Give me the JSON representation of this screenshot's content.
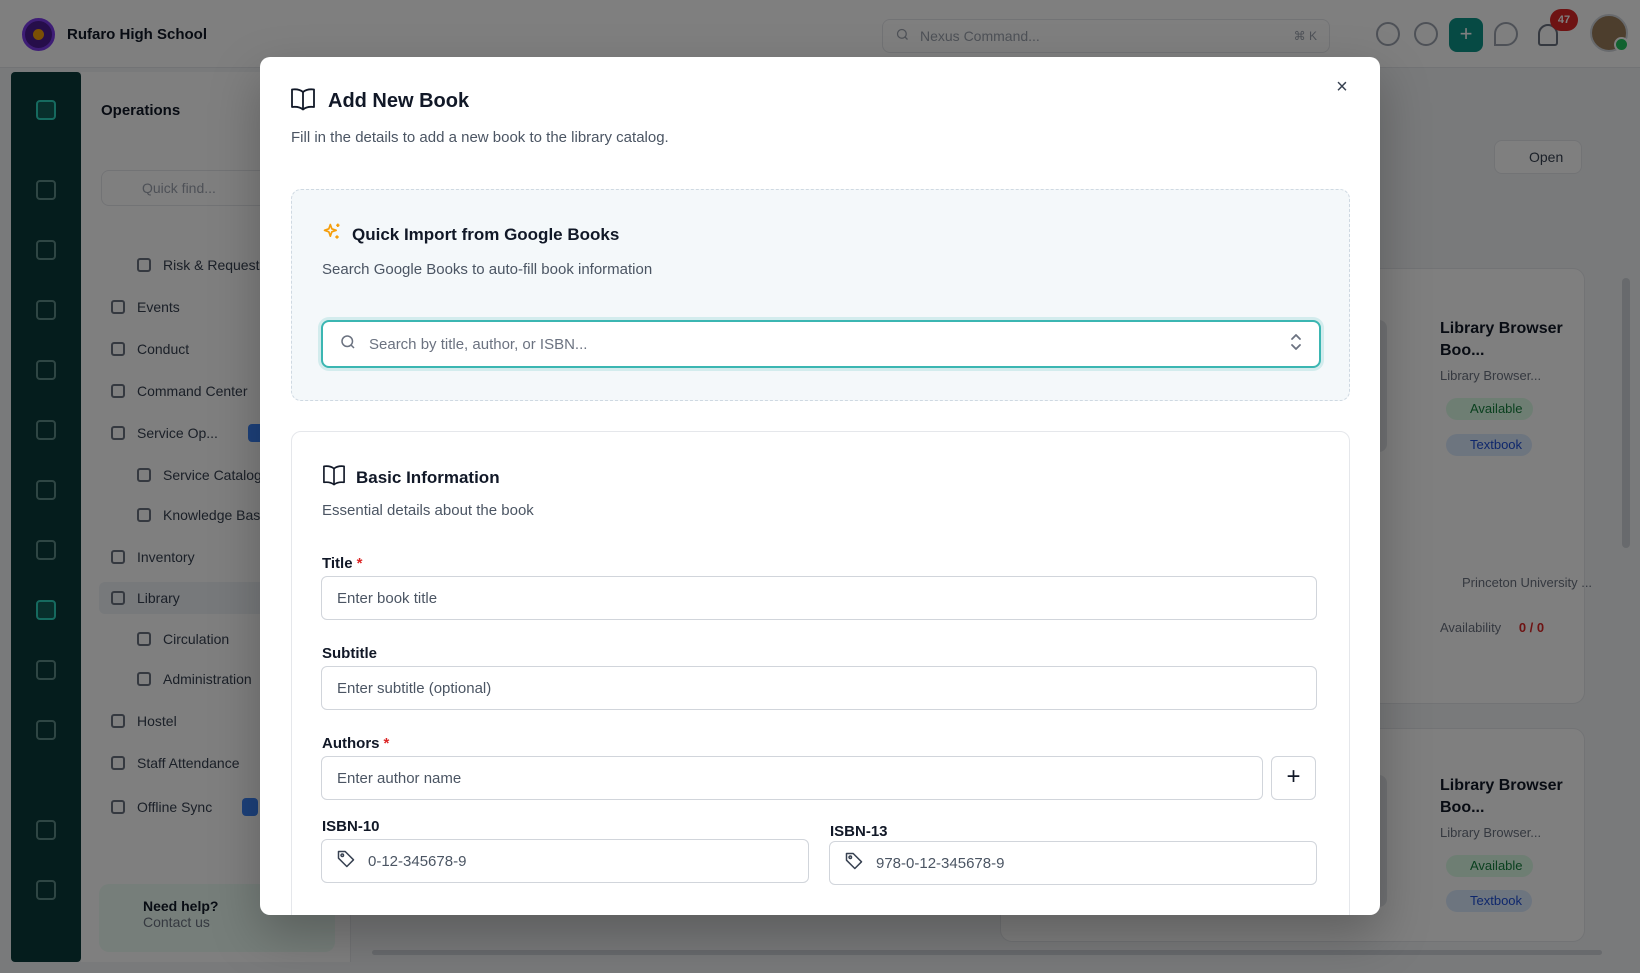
{
  "app": {
    "school_name": "Rufaro High School",
    "command_placeholder": "Nexus Command...",
    "command_shortcut": "⌘ K",
    "notification_count": "47"
  },
  "sidebar": {
    "section_title": "Operations",
    "search_placeholder": "Quick find...",
    "items": [
      {
        "label": "Risk & Requests"
      },
      {
        "label": "Events"
      },
      {
        "label": "Conduct"
      },
      {
        "label": "Command Center"
      },
      {
        "label": "Service Op..."
      },
      {
        "label": "Service Catalog"
      },
      {
        "label": "Knowledge Base"
      },
      {
        "label": "Inventory"
      },
      {
        "label": "Library"
      },
      {
        "label": "Circulation"
      },
      {
        "label": "Administration"
      },
      {
        "label": "Hostel"
      },
      {
        "label": "Staff Attendance"
      },
      {
        "label": "Offline Sync"
      }
    ],
    "help_title": "Need help?",
    "help_link": "Contact us"
  },
  "content": {
    "open_button": "Open",
    "cards": [
      {
        "title": "Library Browser Boo...",
        "subtitle": "Library Browser...",
        "status": "Available",
        "type": "Textbook"
      },
      {
        "title": "Library Browser Boo...",
        "subtitle": "Library Browser...",
        "status": "Available",
        "type": "Textbook"
      }
    ],
    "publisher": "Princeton University ...",
    "availability_label": "Availability",
    "availability_value": "0 / 0"
  },
  "modal": {
    "title": "Add New Book",
    "description": "Fill in the details to add a new book to the library catalog.",
    "close_label": "×",
    "import": {
      "title": "Quick Import from Google Books",
      "description": "Search Google Books to auto-fill book information",
      "search_placeholder": "Search by title, author, or ISBN..."
    },
    "basic": {
      "title": "Basic Information",
      "description": "Essential details about the book",
      "required_mark": "*",
      "title_label": "Title",
      "title_placeholder": "Enter book title",
      "subtitle_label": "Subtitle",
      "subtitle_placeholder": "Enter subtitle (optional)",
      "authors_label": "Authors",
      "authors_placeholder": "Enter author name",
      "add_author_label": "+",
      "isbn10_label": "ISBN-10",
      "isbn10_placeholder": "0-12-345678-9",
      "isbn13_label": "ISBN-13",
      "isbn13_placeholder": "978-0-12-345678-9"
    }
  },
  "colors": {
    "accent": "#3bb6b2",
    "required": "#dc2626",
    "brand": "#0d9488",
    "sparkle": "#f59e0b"
  },
  "icons": {
    "book": "book-open-icon",
    "sparkle": "sparkles-icon",
    "search": "search-icon",
    "chevron": "chevrons-up-down-icon",
    "tag": "tag-icon",
    "close": "close-icon"
  }
}
